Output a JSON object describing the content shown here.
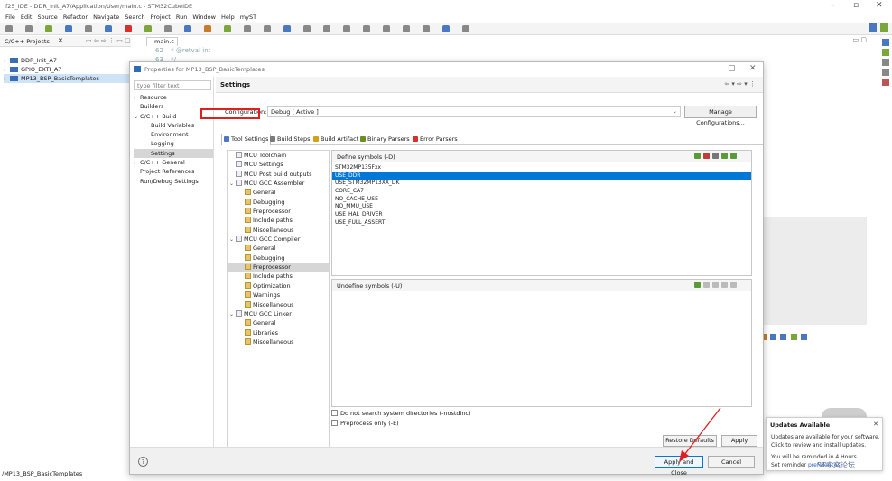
{
  "window": {
    "title": "f25_IDE - DDR_Init_A7/Application/User/main.c - STM32CubeIDE"
  },
  "menu": [
    "File",
    "Edit",
    "Source",
    "Refactor",
    "Navigate",
    "Search",
    "Project",
    "Run",
    "Window",
    "Help",
    "myST"
  ],
  "project_explorer": {
    "tab_label": "C/C++ Projects",
    "projects": [
      {
        "label": "DDR_Init_A7",
        "selected": false
      },
      {
        "label": "GPIO_EXTI_A7",
        "selected": false
      },
      {
        "label": "MP13_BSP_BasicTemplates",
        "selected": true
      }
    ]
  },
  "status_bar": {
    "text": "/MP13_BSP_BasicTemplates"
  },
  "editor": {
    "tab_label": "main.c",
    "lines": [
      {
        "num": "62",
        "text": " * @retval int"
      },
      {
        "num": "63",
        "text": " */"
      }
    ]
  },
  "dialog": {
    "title": "Properties for MP13_BSP_BasicTemplates",
    "filter_placeholder": "type filter text",
    "nav": [
      {
        "label": "Resource",
        "chevron": "›",
        "indent": 0
      },
      {
        "label": "Builders",
        "chevron": "",
        "indent": 0
      },
      {
        "label": "C/C++ Build",
        "chevron": "⌄",
        "indent": 0
      },
      {
        "label": "Build Variables",
        "chevron": "",
        "indent": 1
      },
      {
        "label": "Environment",
        "chevron": "",
        "indent": 1
      },
      {
        "label": "Logging",
        "chevron": "",
        "indent": 1
      },
      {
        "label": "Settings",
        "chevron": "",
        "indent": 1,
        "selected": true
      },
      {
        "label": "C/C++ General",
        "chevron": "›",
        "indent": 0
      },
      {
        "label": "Project References",
        "chevron": "",
        "indent": 0
      },
      {
        "label": "Run/Debug Settings",
        "chevron": "",
        "indent": 0
      }
    ],
    "page_title": "Settings",
    "configuration_label": "Configuration:",
    "configuration_value": "Debug  [ Active ]",
    "manage_button": "Manage Configurations...",
    "tabs": [
      {
        "label": "Tool Settings",
        "active": true,
        "color": "#4a78c0"
      },
      {
        "label": "Build Steps",
        "active": false,
        "color": "#7a7a7a"
      },
      {
        "label": "Build Artifact",
        "active": false,
        "color": "#d4a017"
      },
      {
        "label": "Binary Parsers",
        "active": false,
        "color": "#6b8e23"
      },
      {
        "label": "Error Parsers",
        "active": false,
        "color": "#d9302c"
      }
    ],
    "tool_tree": [
      {
        "label": "MCU Toolchain",
        "indent": 0,
        "chevron": "",
        "kind": "item"
      },
      {
        "label": "MCU Settings",
        "indent": 0,
        "chevron": "",
        "kind": "item"
      },
      {
        "label": "MCU Post build outputs",
        "indent": 0,
        "chevron": "",
        "kind": "item"
      },
      {
        "label": "MCU GCC Assembler",
        "indent": 0,
        "chevron": "⌄",
        "kind": "tool"
      },
      {
        "label": "General",
        "indent": 1,
        "chevron": "",
        "kind": "cat"
      },
      {
        "label": "Debugging",
        "indent": 1,
        "chevron": "",
        "kind": "cat"
      },
      {
        "label": "Preprocessor",
        "indent": 1,
        "chevron": "",
        "kind": "cat"
      },
      {
        "label": "Include paths",
        "indent": 1,
        "chevron": "",
        "kind": "cat"
      },
      {
        "label": "Miscellaneous",
        "indent": 1,
        "chevron": "",
        "kind": "cat"
      },
      {
        "label": "MCU GCC Compiler",
        "indent": 0,
        "chevron": "⌄",
        "kind": "tool"
      },
      {
        "label": "General",
        "indent": 1,
        "chevron": "",
        "kind": "cat"
      },
      {
        "label": "Debugging",
        "indent": 1,
        "chevron": "",
        "kind": "cat"
      },
      {
        "label": "Preprocessor",
        "indent": 1,
        "chevron": "",
        "kind": "cat",
        "selected": true
      },
      {
        "label": "Include paths",
        "indent": 1,
        "chevron": "",
        "kind": "cat"
      },
      {
        "label": "Optimization",
        "indent": 1,
        "chevron": "",
        "kind": "cat"
      },
      {
        "label": "Warnings",
        "indent": 1,
        "chevron": "",
        "kind": "cat"
      },
      {
        "label": "Miscellaneous",
        "indent": 1,
        "chevron": "",
        "kind": "cat"
      },
      {
        "label": "MCU GCC Linker",
        "indent": 0,
        "chevron": "⌄",
        "kind": "tool"
      },
      {
        "label": "General",
        "indent": 1,
        "chevron": "",
        "kind": "cat"
      },
      {
        "label": "Libraries",
        "indent": 1,
        "chevron": "",
        "kind": "cat"
      },
      {
        "label": "Miscellaneous",
        "indent": 1,
        "chevron": "",
        "kind": "cat"
      }
    ],
    "define_symbols": {
      "label": "Define symbols (-D)",
      "items": [
        {
          "label": "STM32MP135Fxx",
          "selected": false
        },
        {
          "label": "USE_DDR",
          "selected": true
        },
        {
          "label": "USE_STM32MP13XX_DK",
          "selected": false
        },
        {
          "label": "CORE_CA7",
          "selected": false
        },
        {
          "label": "NO_CACHE_USE",
          "selected": false
        },
        {
          "label": "NO_MMU_USE",
          "selected": false
        },
        {
          "label": "USE_HAL_DRIVER",
          "selected": false
        },
        {
          "label": "USE_FULL_ASSERT",
          "selected": false
        }
      ]
    },
    "undefine_symbols": {
      "label": "Undefine symbols (-U)",
      "items": []
    },
    "checkboxes": [
      {
        "label": "Do not search system directories (-nostdinc)",
        "checked": false
      },
      {
        "label": "Preprocess only (-E)",
        "checked": false
      }
    ],
    "restore_button": "Restore Defaults",
    "apply_button": "Apply",
    "apply_close_button": "Apply and Close",
    "cancel_button": "Cancel"
  },
  "notification": {
    "title": "Updates Available",
    "line1": "Updates are available for your software.",
    "line2": "Click to review and install updates.",
    "line3": "You will be reminded in 4 Hours.",
    "line4_prefix": "Set reminder",
    "line4_link": "preferences",
    "watermark_text": "ST中文论坛"
  },
  "colors": {
    "selection_blue": "#0078d7",
    "annotation_red": "#e02020",
    "project_icon": "#3c6cb4"
  }
}
